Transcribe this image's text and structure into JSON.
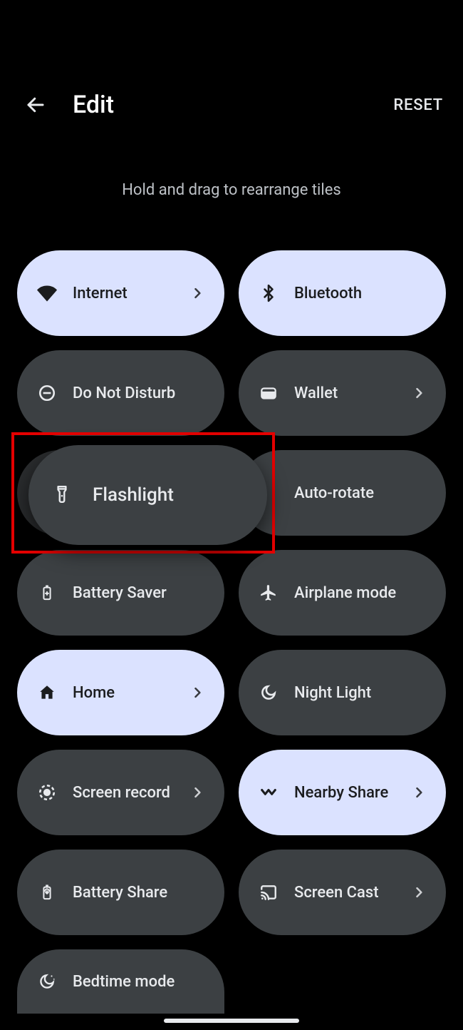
{
  "header": {
    "title": "Edit",
    "reset": "RESET"
  },
  "hint": "Hold and drag to rearrange tiles",
  "tiles": {
    "internet": {
      "label": "Internet"
    },
    "bluetooth": {
      "label": "Bluetooth"
    },
    "dnd": {
      "label": "Do Not Disturb"
    },
    "wallet": {
      "label": "Wallet"
    },
    "flashlight": {
      "label": "Flashlight"
    },
    "autorotate": {
      "label": "Auto-rotate"
    },
    "battery_saver": {
      "label": "Battery Saver"
    },
    "airplane": {
      "label": "Airplane mode"
    },
    "home": {
      "label": "Home"
    },
    "night_light": {
      "label": "Night Light"
    },
    "screen_record": {
      "label": "Screen record"
    },
    "nearby_share": {
      "label": "Nearby Share"
    },
    "battery_share": {
      "label": "Battery Share"
    },
    "screen_cast": {
      "label": "Screen Cast"
    },
    "bedtime": {
      "label": "Bedtime mode"
    }
  }
}
